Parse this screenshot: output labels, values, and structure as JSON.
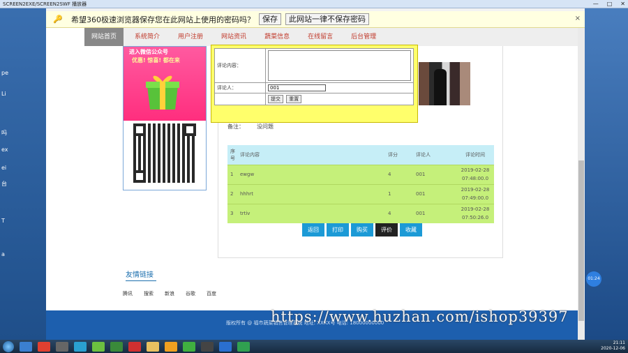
{
  "window": {
    "title": "SCREEN2EXE/SCREEN2SWF 播放器",
    "controls": [
      "—",
      "□",
      "✕"
    ]
  },
  "password_bar": {
    "message": "希望360极速浏览器保存您在此网站上使用的密码吗？",
    "save_label": "保存",
    "never_label": "此网站一律不保存密码",
    "close": "×"
  },
  "nav": {
    "items": [
      {
        "label": "网站首页",
        "active": true
      },
      {
        "label": "系统简介",
        "active": false
      },
      {
        "label": "用户注册",
        "active": false
      },
      {
        "label": "网站资讯",
        "active": false
      },
      {
        "label": "蔬菜信息",
        "active": false
      },
      {
        "label": "在线留言",
        "active": false
      },
      {
        "label": "后台管理",
        "active": false
      }
    ]
  },
  "promo": {
    "banner": "进入微信公众号",
    "sub": "优惠! 惊喜! 都在来"
  },
  "form": {
    "content_label": "评论内容：",
    "commenter_label": "评论人：",
    "commenter_value": "001",
    "submit_label": "提交",
    "reset_label": "重置"
  },
  "detail": {
    "remark_label": "备注：",
    "remark_value": "没问题"
  },
  "comments": {
    "headers": [
      "序号",
      "评论内容",
      "评分",
      "评论人",
      "评论时间"
    ],
    "rows": [
      {
        "no": "1",
        "content": "ewgw",
        "score": "4",
        "user": "001",
        "date": "2019-02-28",
        "time": "07:48:00.0"
      },
      {
        "no": "2",
        "content": "hhhrt",
        "score": "1",
        "user": "001",
        "date": "2019-02-28",
        "time": "07:49:00.0"
      },
      {
        "no": "3",
        "content": "trtiv",
        "score": "4",
        "user": "001",
        "date": "2019-02-28",
        "time": "07:50:26.0"
      }
    ]
  },
  "actions": {
    "back": "返回",
    "print": "打印",
    "buy": "购买",
    "comment": "评价",
    "favorite": "收藏"
  },
  "links": {
    "title": "友情链接",
    "items": [
      "腾讯",
      "搜索",
      "新浪",
      "谷歌",
      "百度"
    ]
  },
  "footer": {
    "text": "版权所有 @ 福市蔬菜销售管理系统 地址: XXXX号 电话: 18000000000"
  },
  "watermark": "https://www.huzhan.com/ishop39397",
  "float_badge": "01:24",
  "tray": {
    "time": "21:11",
    "date": "2020-12-06"
  },
  "desktop_labels": [
    "pe",
    "Li",
    "吗",
    "ex",
    "ei",
    "台",
    "T",
    "a"
  ]
}
